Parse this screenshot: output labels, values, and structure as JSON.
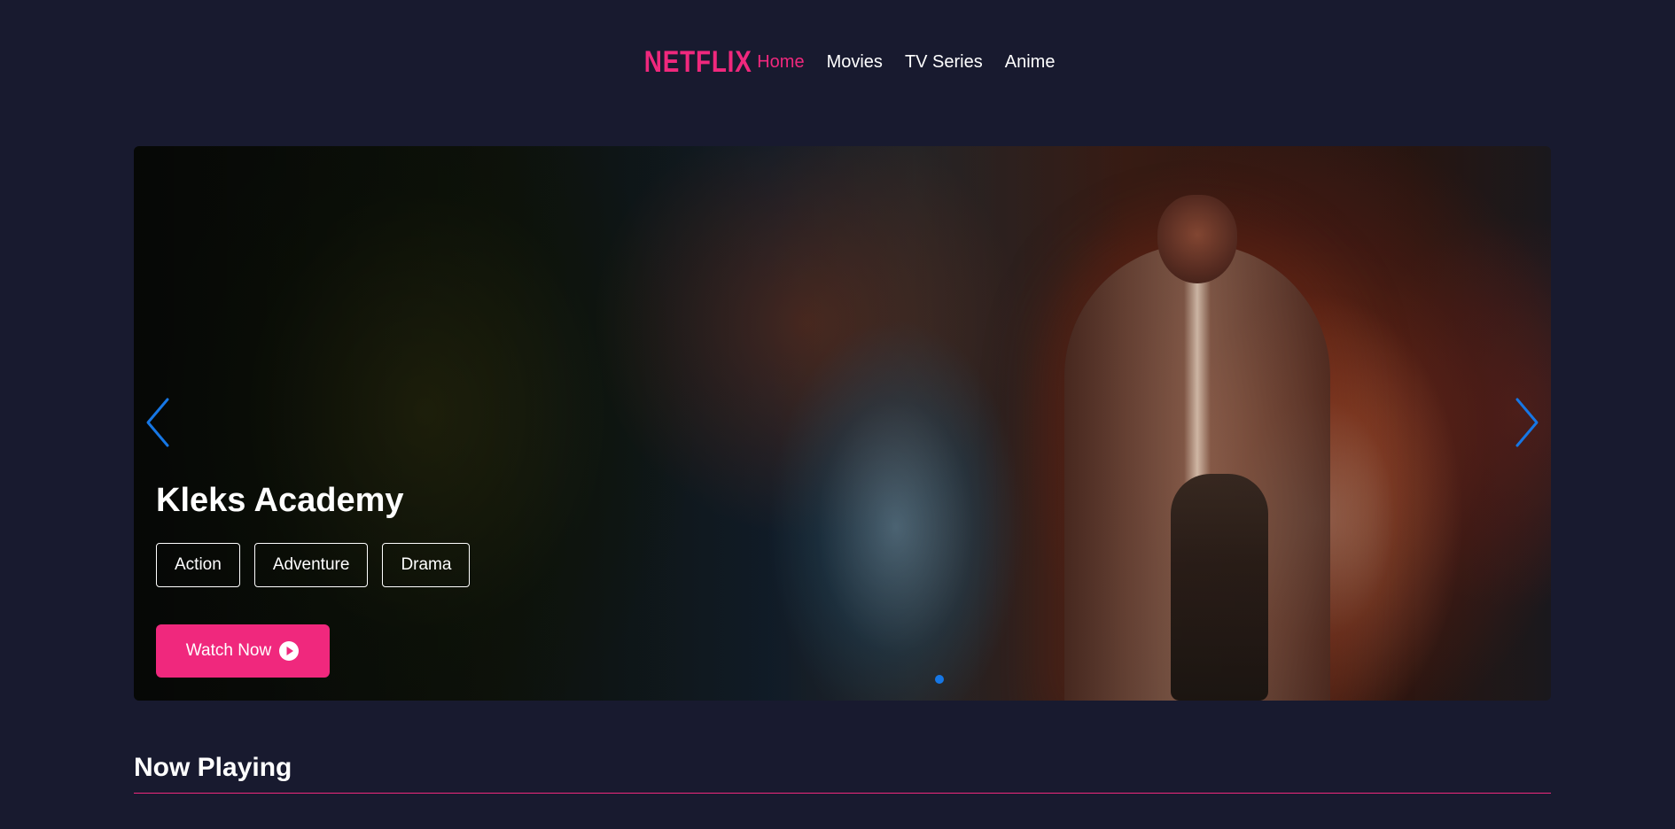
{
  "colors": {
    "accent": "#f0287d",
    "background": "#181a2f",
    "arrow": "#1677e5",
    "dot_active": "#1677e5"
  },
  "header": {
    "logo": "NETFLIX",
    "nav": [
      {
        "label": "Home",
        "active": true
      },
      {
        "label": "Movies",
        "active": false
      },
      {
        "label": "TV Series",
        "active": false
      },
      {
        "label": "Anime",
        "active": false
      }
    ]
  },
  "hero": {
    "title": "Kleks Academy",
    "genres": [
      "Action",
      "Adventure",
      "Drama"
    ],
    "watch_label": "Watch Now",
    "icons": {
      "prev": "chevron-left-icon",
      "next": "chevron-right-icon",
      "play": "play-circle-icon"
    },
    "active_slide": 1
  },
  "now_playing": {
    "title": "Now Playing"
  }
}
